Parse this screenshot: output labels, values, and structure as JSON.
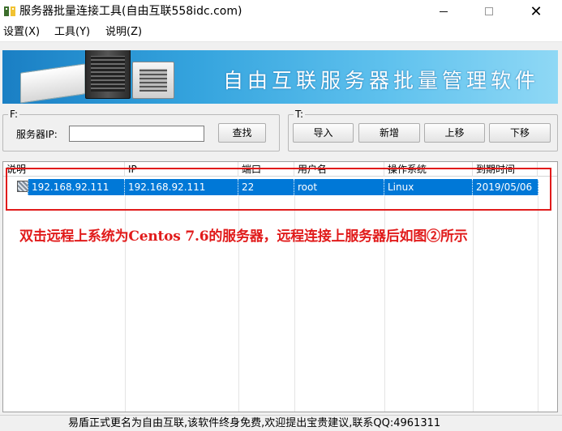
{
  "window": {
    "title": "服务器批量连接工具(自由互联558idc.com)",
    "app_icon": "app-icon",
    "close_glyph": "✕"
  },
  "menu": [
    {
      "label": "设置(X)"
    },
    {
      "label": "工具(Y)"
    },
    {
      "label": "说明(Z)"
    }
  ],
  "banner": {
    "title": "自由互联服务器批量管理软件"
  },
  "search_group": {
    "label": "F:",
    "field_label": "服务器IP:",
    "ip_value": "",
    "search_button": "查找"
  },
  "tools_group": {
    "label": "T:",
    "import_button": "导入",
    "add_button": "新增",
    "move_up_button": "上移",
    "move_down_button": "下移"
  },
  "table": {
    "columns": [
      "说明",
      "IP",
      "端口",
      "用户名",
      "操作系统",
      "到期时间"
    ],
    "rows": [
      {
        "selected": true,
        "icon": "server-icon",
        "cells": [
          "192.168.92.111",
          "192.168.92.111",
          "22",
          "root",
          "Linux",
          "2019/05/06"
        ]
      }
    ]
  },
  "annotation": {
    "text": "双击远程上系统为Centos 7.6的服务器，远程连接上服务器后如图②所示",
    "color": "#e11b1b"
  },
  "status_bar": {
    "text": "易盾正式更名为自由互联,该软件终身免费,欢迎提出宝贵建议,联系QQ:4961311"
  },
  "colors": {
    "selection": "#0078d7",
    "banner_start": "#1a7fc4",
    "banner_end": "#8fd8f5"
  }
}
